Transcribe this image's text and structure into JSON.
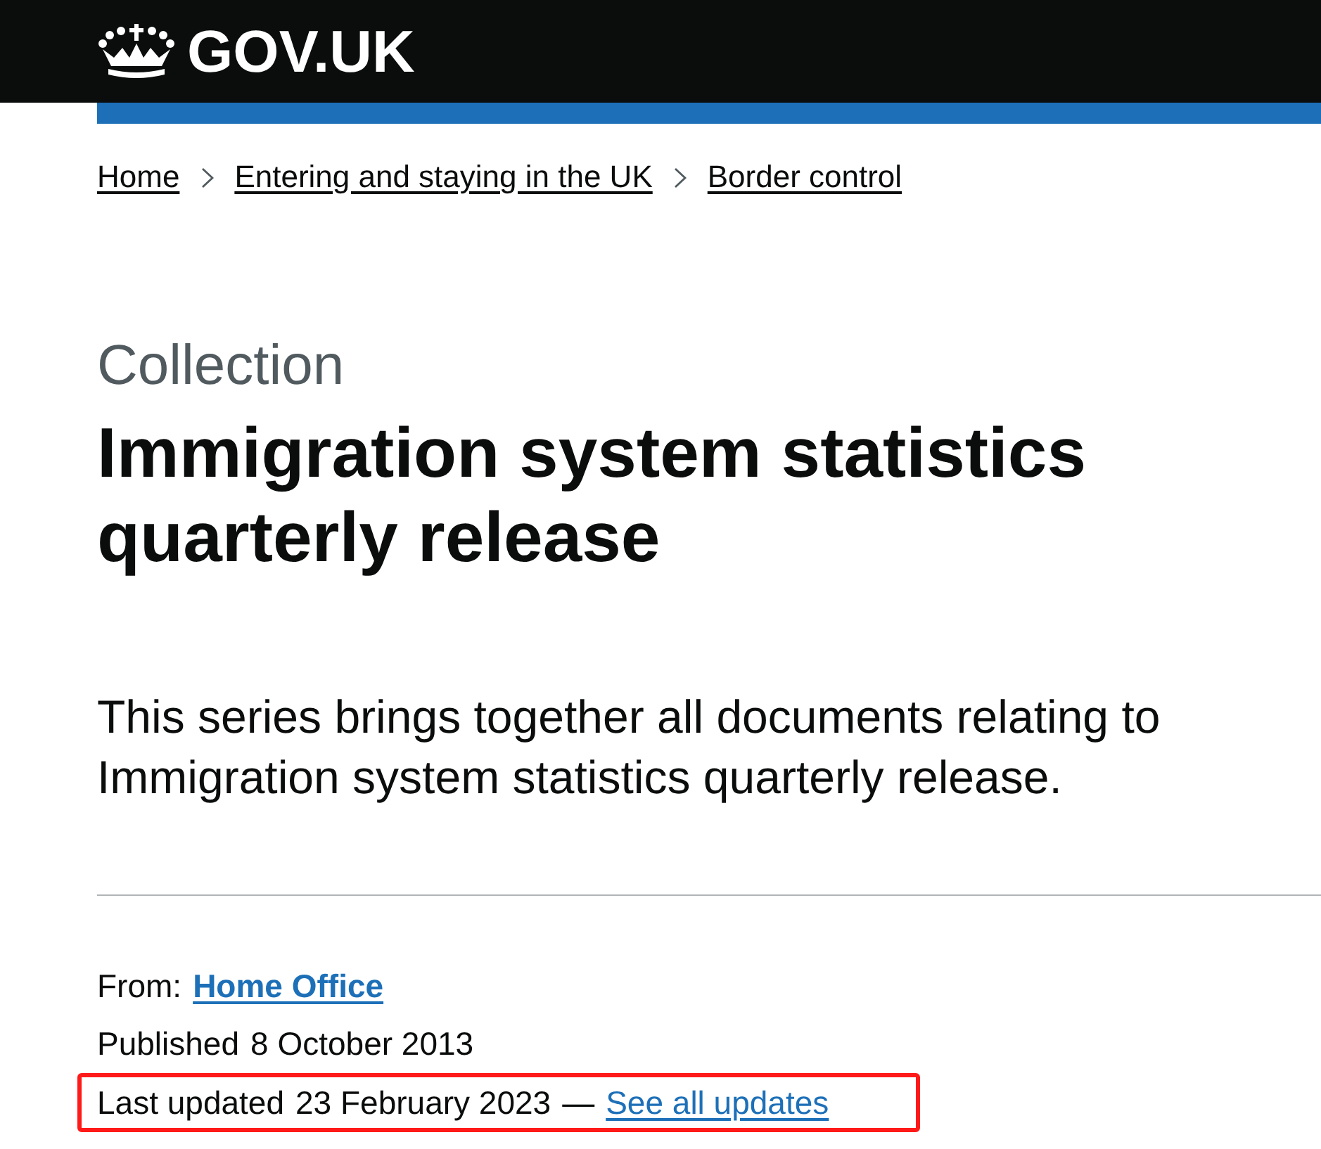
{
  "header": {
    "logo_text": "GOV.UK"
  },
  "breadcrumbs": [
    {
      "label": "Home"
    },
    {
      "label": "Entering and staying in the UK"
    },
    {
      "label": "Border control"
    }
  ],
  "page": {
    "context": "Collection",
    "title": "Immigration system statistics quarterly release",
    "lead": "This series brings together all documents relating to Immigration system statistics quarterly release."
  },
  "metadata": {
    "from_label": "From:",
    "from_link": "Home Office",
    "published_label": "Published",
    "published_date": "8 October 2013",
    "updated_label": "Last updated",
    "updated_date": "23 February 2023",
    "separator": "—",
    "updates_link": "See all updates",
    "highlighted": true
  }
}
